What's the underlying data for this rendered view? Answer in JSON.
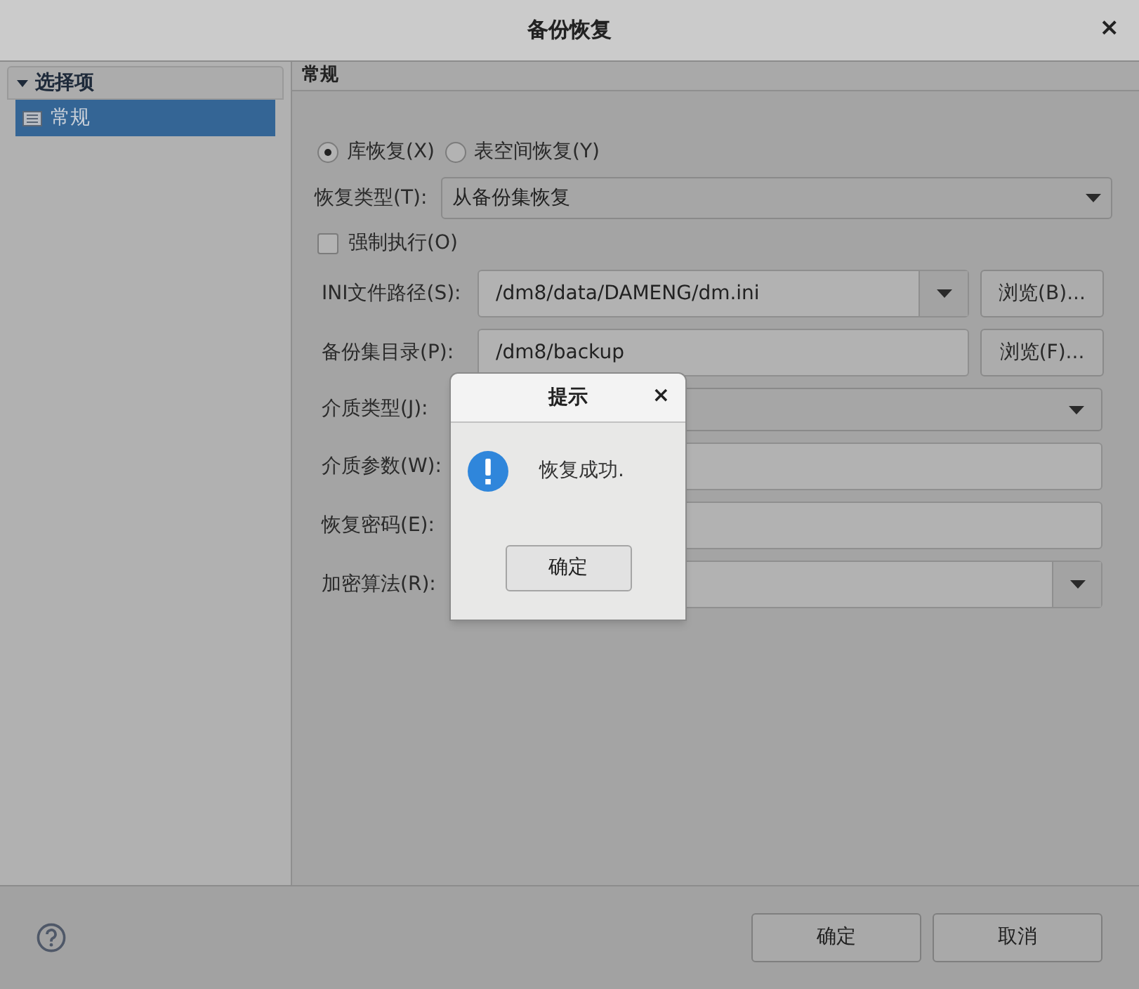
{
  "window": {
    "title": "备份恢复",
    "close": "×"
  },
  "sidebar": {
    "header": "选择项",
    "expanded": true,
    "items": [
      {
        "label": "常规",
        "selected": true
      }
    ]
  },
  "panel": {
    "title": "常规"
  },
  "restore_mode": [
    {
      "label": "库恢复(X)",
      "selected": true
    },
    {
      "label": "表空间恢复(Y)",
      "selected": false
    }
  ],
  "restore_type": {
    "label": "恢复类型(T):",
    "value": "从备份集恢复"
  },
  "force": {
    "label": "强制执行(O)",
    "checked": false
  },
  "fields": [
    {
      "kind": "combo-browse",
      "label": "INI文件路径(S):",
      "value": "/dm8/data/DAMENG/dm.ini",
      "button": "浏览(B)..."
    },
    {
      "kind": "browse",
      "label": "备份集目录(P):",
      "value": "/dm8/backup",
      "button": "浏览(F)..."
    },
    {
      "kind": "select",
      "label": "介质类型(J):"
    },
    {
      "kind": "text",
      "label": "介质参数(W):"
    },
    {
      "kind": "text",
      "label": "恢复密码(E):"
    },
    {
      "kind": "combo",
      "label": "加密算法(R):"
    }
  ],
  "buttons": [
    "确定",
    "取消"
  ],
  "message_box": {
    "title": "提示",
    "close": "×",
    "message": "恢复成功.",
    "button": "确定"
  }
}
